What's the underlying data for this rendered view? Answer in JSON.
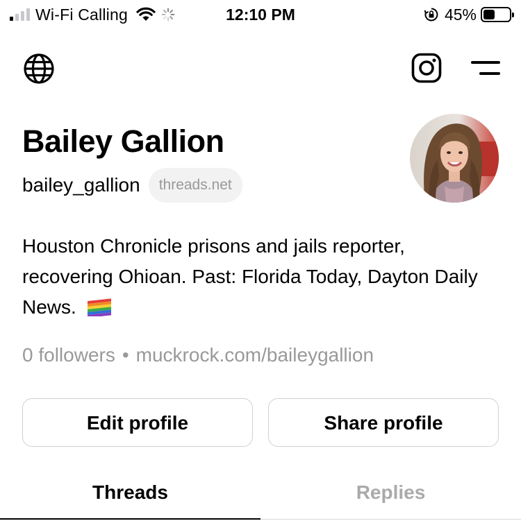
{
  "status_bar": {
    "carrier": "Wi-Fi Calling",
    "time": "12:10 PM",
    "battery_percent": "45%",
    "battery_level": 0.45,
    "signal_bars_active": 1,
    "icons": [
      "signal-icon",
      "wifi-icon",
      "activity-spinner-icon",
      "rotation-lock-icon",
      "battery-icon"
    ]
  },
  "nav": {
    "left_icon": "globe-icon",
    "right_icons": [
      "instagram-icon",
      "menu-icon"
    ]
  },
  "profile": {
    "name": "Bailey Gallion",
    "handle": "bailey_gallion",
    "domain_chip": "threads.net",
    "bio": "Houston Chronicle prisons and jails reporter, recovering Ohioan. Past: Florida Today, Dayton Daily News.",
    "bio_emoji": "rainbow-flag-icon",
    "followers": "0 followers",
    "separator": "•",
    "link": "muckrock.com/baileygallion"
  },
  "buttons": {
    "edit": "Edit profile",
    "share": "Share profile"
  },
  "tabs": [
    {
      "label": "Threads",
      "active": true
    },
    {
      "label": "Replies",
      "active": false
    }
  ],
  "colors": {
    "text_primary": "#000000",
    "text_muted": "#999999",
    "tab_inactive": "#aaaaaa",
    "chip_bg": "#f2f2f2",
    "button_border": "#d0d0d0"
  }
}
